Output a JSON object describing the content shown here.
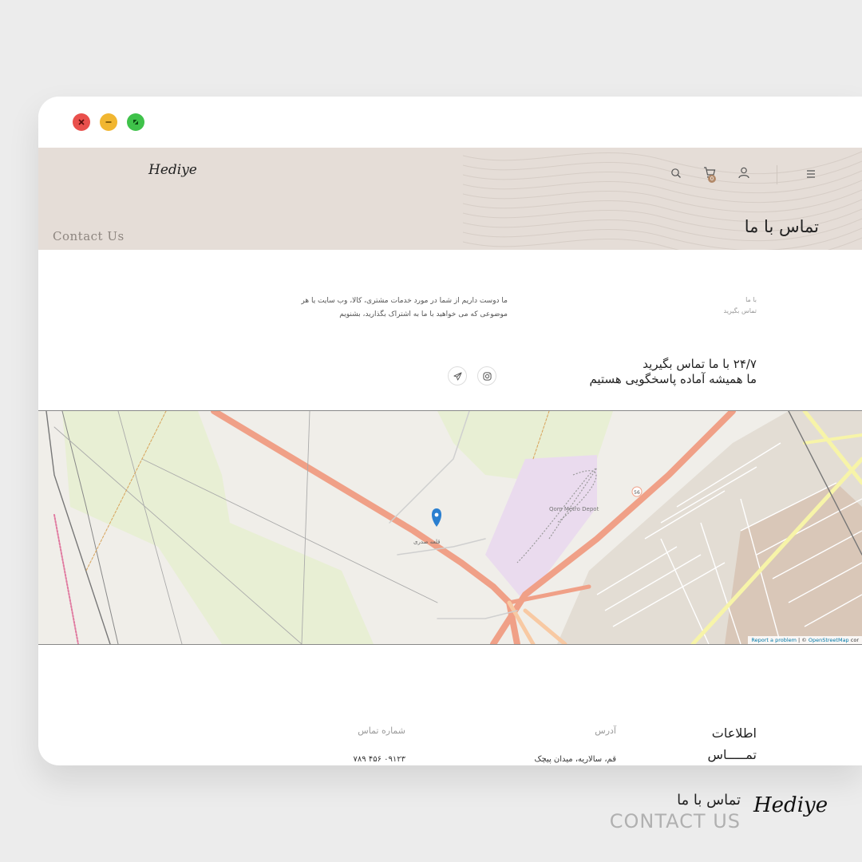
{
  "window_controls": {
    "close": "close-icon",
    "minimize": "minimize-icon",
    "maximize": "maximize-icon"
  },
  "header": {
    "logo": "Hediye",
    "icons": [
      "menu-icon",
      "user-icon",
      "cart-icon",
      "search-icon"
    ],
    "cart_count": "0",
    "page_title": "تماس با ما",
    "page_title_en": "Contact Us"
  },
  "breadcrumb": {
    "line1": "با ما",
    "line2": "تماس بگیرید"
  },
  "intro": {
    "text": "ما دوست داریم از شما در مورد خدمات مشتری، کالا، وب سایت یا هر موضوعی که می خواهید با ما به اشتراک بگذارید، بشنویم"
  },
  "contact_heading": {
    "line1": "۲۴/۷ با ما تماس بگیرید",
    "line2": "ما همیشه آماده پاسخگویی هستیم"
  },
  "social": [
    "instagram-icon",
    "telegram-icon"
  ],
  "map": {
    "labels": {
      "metro": "Qom Metro Depot",
      "village": "قلعه صدری",
      "road_num": "56"
    },
    "attribution_link1": "Report a problem",
    "attribution_sep": " | © ",
    "attribution_link2": "OpenStreetMap",
    "attribution_tail": " cor"
  },
  "contact_info": {
    "title_line1": "اطلاعات",
    "title_line2": "تمـــــاس",
    "address_label": "آدرس",
    "address_value": "قم، سالاریه، میدان پیچک",
    "phone_label": "شماره تماس",
    "phone_value": "۰۹۱۲۳ ۴۵۶ ۷۸۹"
  },
  "caption": {
    "fa": "تماس با ما",
    "en": "CONTACT US",
    "brand": "Hediye"
  },
  "colors": {
    "header_bg": "#e5ddd7",
    "close": "#e9504c",
    "minimize": "#f1b630",
    "maximize": "#3fc24a",
    "marker": "#2a7fd0",
    "road": "#f0a087"
  }
}
